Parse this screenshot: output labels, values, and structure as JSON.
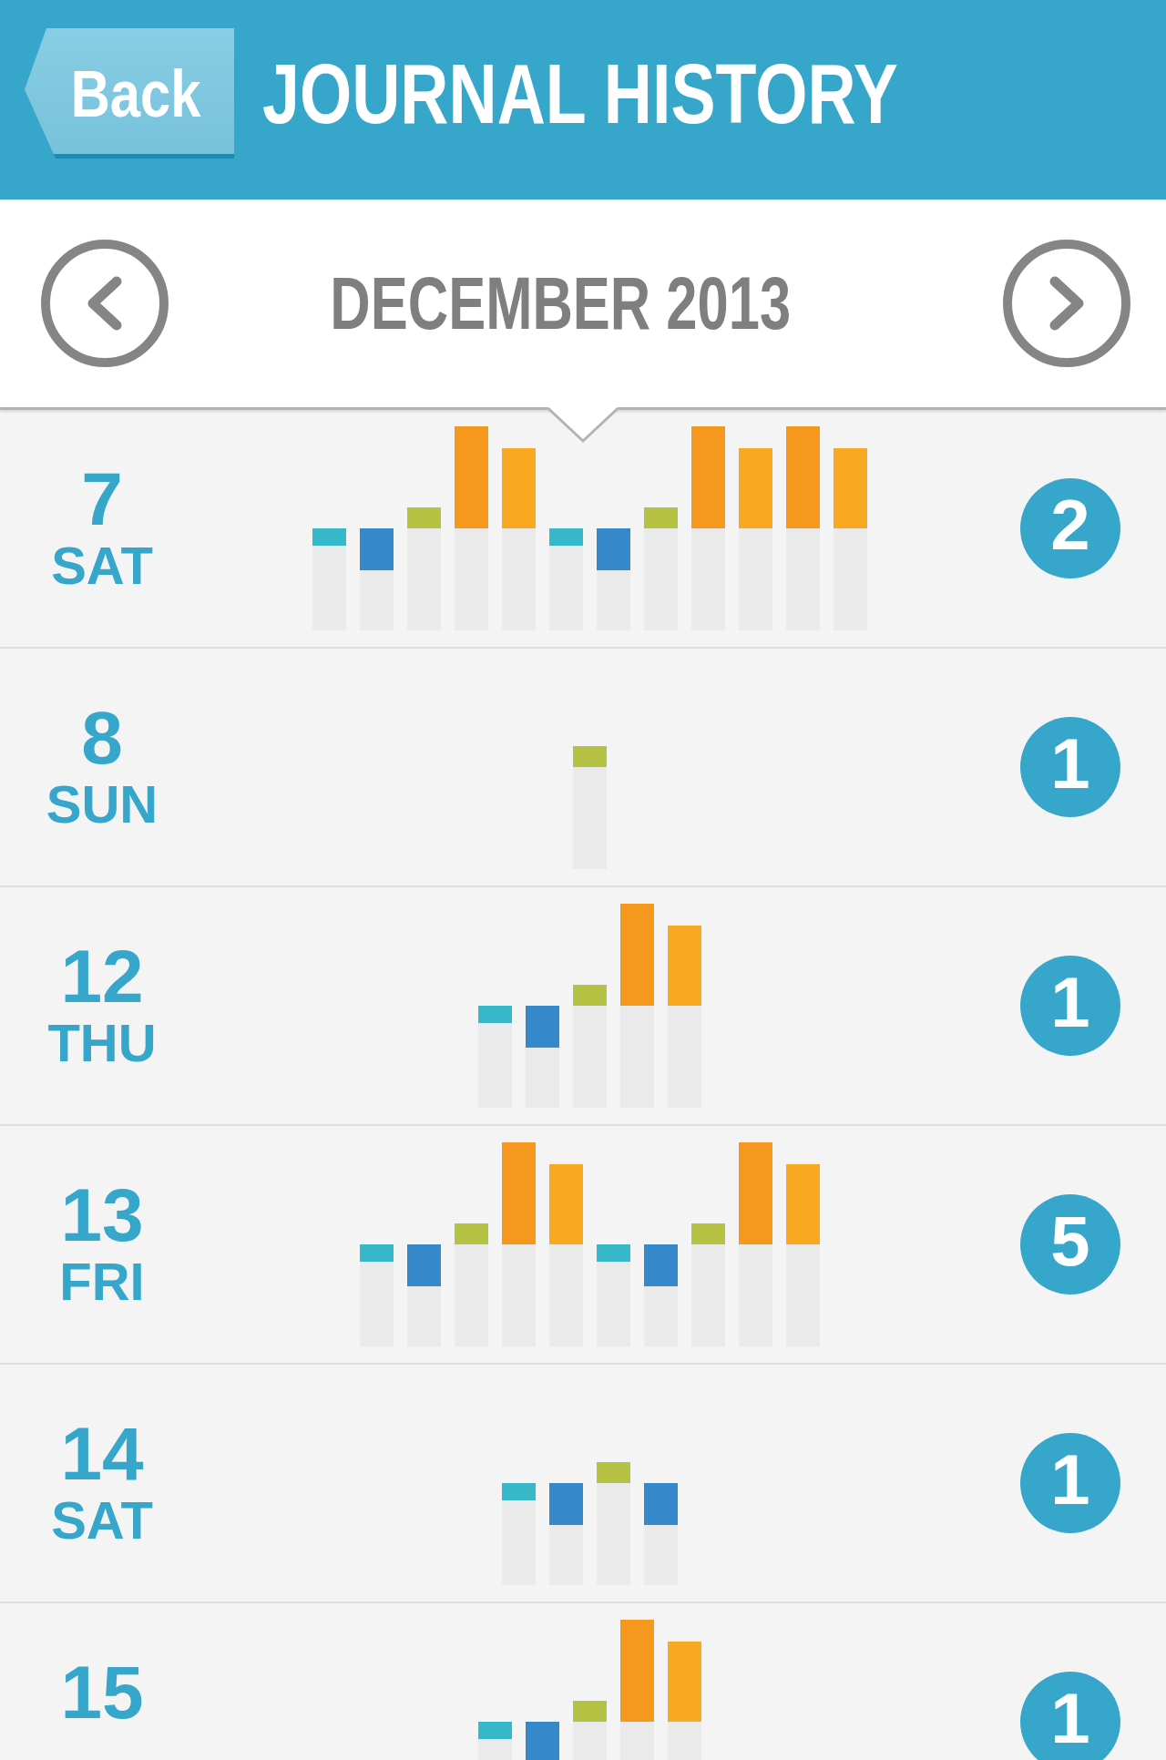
{
  "header": {
    "back_button": "Back",
    "title": "JOURNAL HISTORY"
  },
  "month_nav": {
    "title": "DECEMBER 2013"
  },
  "rows": [
    {
      "day": "7",
      "weekday": "SAT",
      "count": "2",
      "bars": [
        {
          "kind": "cap",
          "color": "#36b8c9"
        },
        {
          "kind": "block",
          "color": "#3589ca"
        },
        {
          "kind": "step",
          "color": "#b6c243"
        },
        {
          "kind": "peak",
          "color": "#f7981e"
        },
        {
          "kind": "high",
          "color": "#f8a921"
        },
        {
          "kind": "cap",
          "color": "#36b8c9"
        },
        {
          "kind": "block",
          "color": "#3589ca"
        },
        {
          "kind": "step",
          "color": "#b6c243"
        },
        {
          "kind": "peak",
          "color": "#f7981e"
        },
        {
          "kind": "high",
          "color": "#f8a921"
        },
        {
          "kind": "peak",
          "color": "#f7981e"
        },
        {
          "kind": "high",
          "color": "#f8a921"
        }
      ]
    },
    {
      "day": "8",
      "weekday": "SUN",
      "count": "1",
      "bars": [
        {
          "kind": "step",
          "color": "#b6c243"
        }
      ]
    },
    {
      "day": "12",
      "weekday": "THU",
      "count": "1",
      "bars": [
        {
          "kind": "cap",
          "color": "#36b8c9"
        },
        {
          "kind": "block",
          "color": "#3589ca"
        },
        {
          "kind": "step",
          "color": "#b6c243"
        },
        {
          "kind": "peak",
          "color": "#f7981e"
        },
        {
          "kind": "high",
          "color": "#f8a921"
        }
      ]
    },
    {
      "day": "13",
      "weekday": "FRI",
      "count": "5",
      "bars": [
        {
          "kind": "cap",
          "color": "#36b8c9"
        },
        {
          "kind": "block",
          "color": "#3589ca"
        },
        {
          "kind": "step",
          "color": "#b6c243"
        },
        {
          "kind": "peak",
          "color": "#f7981e"
        },
        {
          "kind": "high",
          "color": "#f8a921"
        },
        {
          "kind": "cap",
          "color": "#36b8c9"
        },
        {
          "kind": "block",
          "color": "#3589ca"
        },
        {
          "kind": "step",
          "color": "#b6c243"
        },
        {
          "kind": "peak",
          "color": "#f7981e"
        },
        {
          "kind": "high",
          "color": "#f8a921"
        }
      ]
    },
    {
      "day": "14",
      "weekday": "SAT",
      "count": "1",
      "bars": [
        {
          "kind": "cap",
          "color": "#36b8c9"
        },
        {
          "kind": "block",
          "color": "#3589ca"
        },
        {
          "kind": "step",
          "color": "#b6c243"
        },
        {
          "kind": "block",
          "color": "#3589ca"
        }
      ]
    },
    {
      "day": "15",
      "count": "1",
      "bars": [
        {
          "kind": "cap",
          "color": "#36b8c9"
        },
        {
          "kind": "block",
          "color": "#3589ca"
        },
        {
          "kind": "step",
          "color": "#b6c243"
        },
        {
          "kind": "peak",
          "color": "#f7981e"
        },
        {
          "kind": "high",
          "color": "#f8a921"
        }
      ]
    }
  ]
}
